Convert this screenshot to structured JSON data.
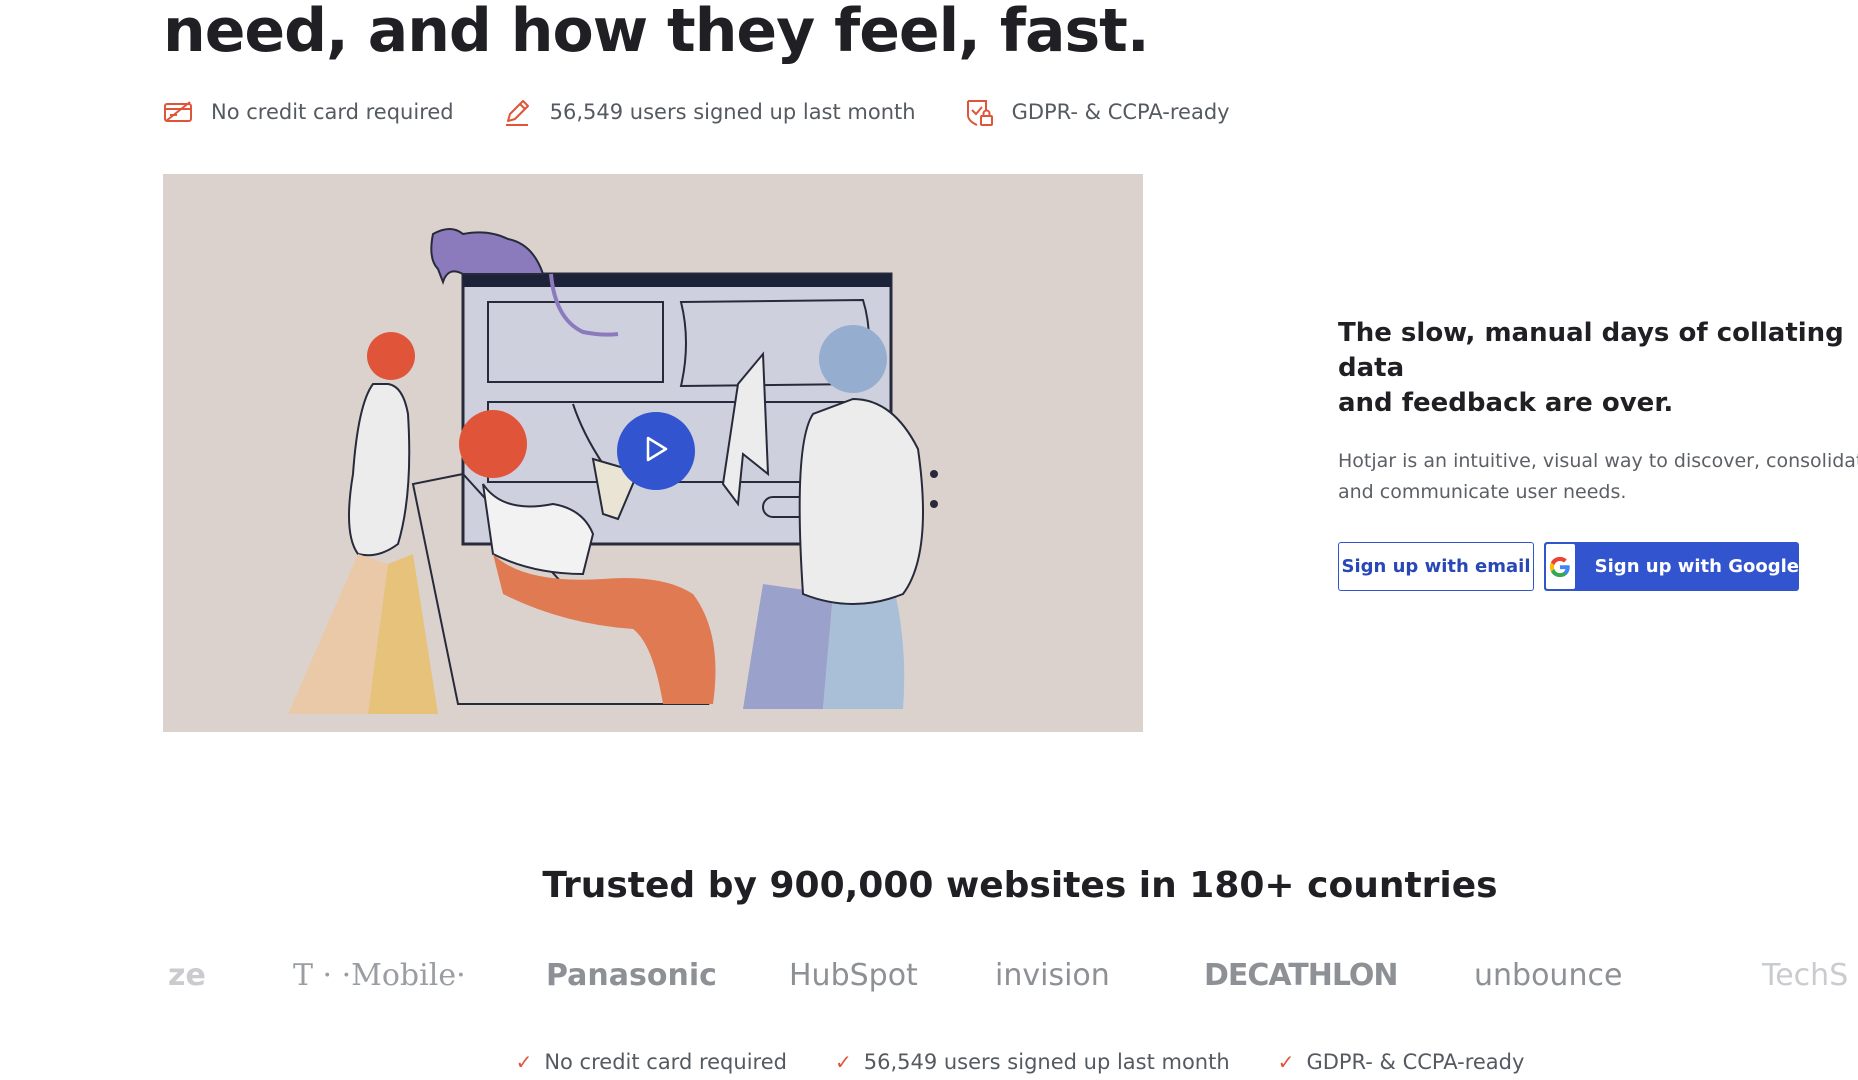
{
  "hero": {
    "headline": "need, and how they feel, fast.",
    "badges": [
      {
        "icon": "credit-card-slash-icon",
        "label": "No credit card required"
      },
      {
        "icon": "pencil-icon",
        "label": "56,549 users signed up last month"
      },
      {
        "icon": "shield-lock-icon",
        "label": "GDPR- & CCPA-ready"
      }
    ],
    "video": {
      "play_icon": "play-icon"
    }
  },
  "side": {
    "title_line1": "The slow, manual days of collating data",
    "title_line2": "and feedback are over.",
    "sub_line1": "Hotjar is an intuitive, visual way to discover, consolidat",
    "sub_line2": "and communicate user needs."
  },
  "cta": {
    "email_label": "Sign up with email",
    "google_label": "Sign up with Google"
  },
  "trusted": {
    "title": "Trusted by 900,000 websites in 180+ countries",
    "logos": [
      "ze",
      "T · ·Mobile·",
      "Panasonic",
      "HubSpot",
      "invision",
      "DECATHLON",
      "unbounce",
      "TechS"
    ]
  },
  "footer_badges": [
    "No credit card required",
    "56,549 users signed up last month",
    "GDPR- & CCPA-ready"
  ],
  "colors": {
    "accent": "#3255cf",
    "warm": "#e0553a",
    "video_bg": "#dcd2cd"
  }
}
